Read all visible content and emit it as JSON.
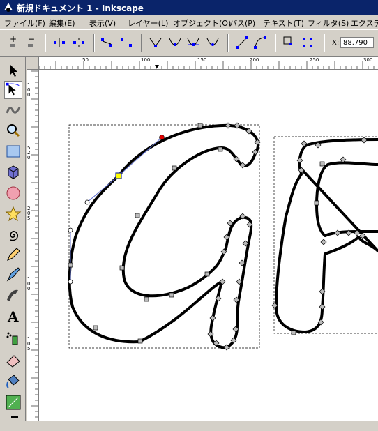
{
  "window": {
    "title": "新規ドキュメント 1 - Inkscape"
  },
  "menu": [
    {
      "label": "ファイル(F)"
    },
    {
      "label": "編集(E)"
    },
    {
      "label": "表示(V)"
    },
    {
      "label": "レイヤー(L)"
    },
    {
      "label": "オブジェクト(O)"
    },
    {
      "label": "パス(P)"
    },
    {
      "label": "テキスト(T)"
    },
    {
      "label": "フィルタ(S)"
    },
    {
      "label": "エクステン"
    }
  ],
  "controls": {
    "x_label": "X:",
    "x_value": "88.790"
  },
  "ruler": {
    "h_labels": [
      "50",
      "100",
      "150",
      "200",
      "250",
      "300"
    ],
    "v_labels": [
      "1",
      "0",
      "0",
      "5",
      "2",
      "0",
      "2",
      "0",
      "5",
      "1",
      "0",
      "0",
      "1",
      "0",
      "5"
    ]
  },
  "colors": {
    "titlebar": "#0a246a",
    "node_selected": "#ffff00",
    "node_end": "#e00000",
    "path_stroke": "#000000"
  }
}
